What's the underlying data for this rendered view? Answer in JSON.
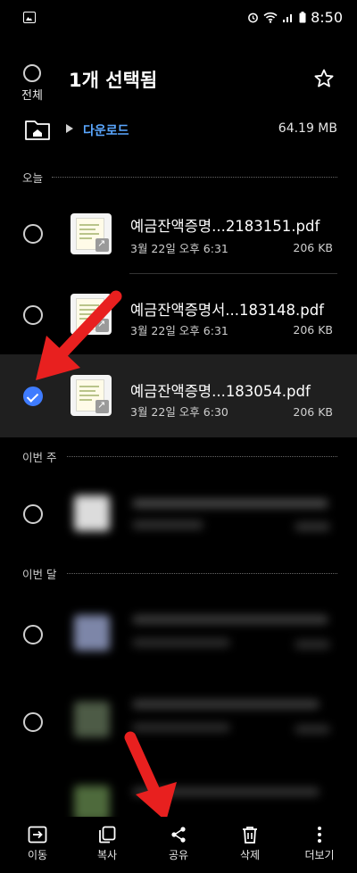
{
  "status_bar": {
    "time": "8:50"
  },
  "header": {
    "select_all_label": "전체",
    "title": "1개 선택됨"
  },
  "path": {
    "folder": "다운로드",
    "size": "64.19 MB"
  },
  "sections": {
    "today": "오늘",
    "this_week": "이번 주",
    "this_month": "이번 달"
  },
  "files": [
    {
      "name": "예금잔액증명...2183151.pdf",
      "date": "3월 22일 오후 6:31",
      "size": "206 KB",
      "selected": false
    },
    {
      "name": "예금잔액증명서...183148.pdf",
      "date": "3월 22일 오후 6:31",
      "size": "206 KB",
      "selected": false
    },
    {
      "name": "예금잔액증명...183054.pdf",
      "date": "3월 22일 오후 6:30",
      "size": "206 KB",
      "selected": true
    }
  ],
  "actions": [
    {
      "label": "이동",
      "icon": "move-icon"
    },
    {
      "label": "복사",
      "icon": "copy-icon"
    },
    {
      "label": "공유",
      "icon": "share-icon"
    },
    {
      "label": "삭제",
      "icon": "trash-icon"
    },
    {
      "label": "더보기",
      "icon": "more-icon"
    }
  ],
  "colors": {
    "accent": "#3f7cff",
    "link": "#5aa7ff",
    "arrow": "#e8201f",
    "selected_row": "#1f1f1f"
  }
}
